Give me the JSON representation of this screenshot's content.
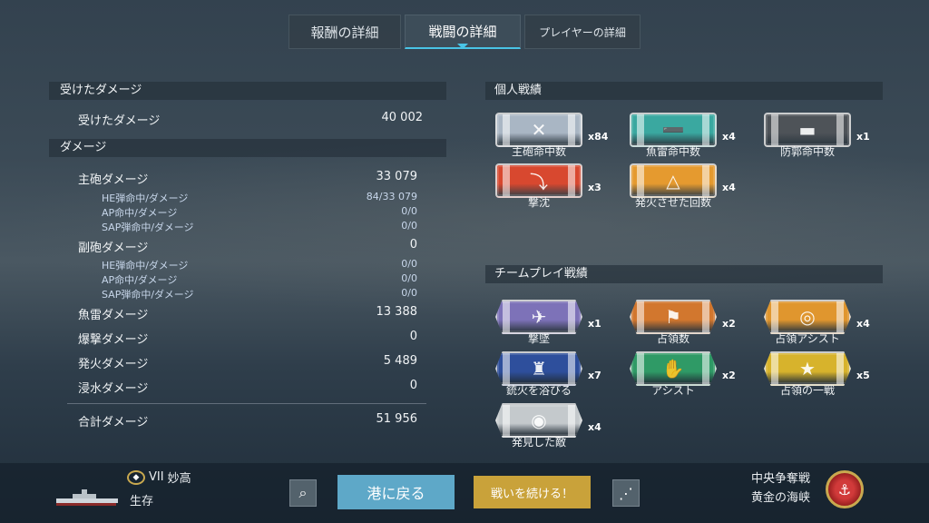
{
  "tabs": [
    "報酬の詳細",
    "戦闘の詳細",
    "プレイヤーの詳細"
  ],
  "left": {
    "received_header": "受けたダメージ",
    "received_label": "受けたダメージ",
    "received_value": "40 002",
    "damage_header": "ダメージ",
    "main_label": "主砲ダメージ",
    "main_value": "33 079",
    "main_he_label": "HE弾命中/ダメージ",
    "main_he_value": "84/33 079",
    "main_ap_label": "AP命中/ダメージ",
    "main_ap_value": "0/0",
    "main_sap_label": "SAP弾命中/ダメージ",
    "main_sap_value": "0/0",
    "sec_label": "副砲ダメージ",
    "sec_value": "0",
    "sec_he_label": "HE弾命中/ダメージ",
    "sec_he_value": "0/0",
    "sec_ap_label": "AP命中/ダメージ",
    "sec_ap_value": "0/0",
    "sec_sap_label": "SAP弾命中/ダメージ",
    "sec_sap_value": "0/0",
    "torp_label": "魚雷ダメージ",
    "torp_value": "13 388",
    "bomb_label": "爆撃ダメージ",
    "bomb_value": "0",
    "fire_label": "発火ダメージ",
    "fire_value": "5 489",
    "flood_label": "浸水ダメージ",
    "flood_value": "0",
    "total_label": "合計ダメージ",
    "total_value": "51 956"
  },
  "personal": {
    "header": "個人戦績",
    "medals": [
      {
        "label": "主砲命中数",
        "count": "x84",
        "color": "#a9b6c4",
        "glyph": "✕"
      },
      {
        "label": "魚雷命中数",
        "count": "x4",
        "color": "#3aa8a0",
        "glyph": "➖"
      },
      {
        "label": "防郭命中数",
        "count": "x1",
        "color": "#4e5358",
        "glyph": "▬"
      },
      {
        "label": "撃沈",
        "count": "x3",
        "color": "#d8482f",
        "glyph": "⤵"
      },
      {
        "label": "発火させた回数",
        "count": "x4",
        "color": "#e59a2f",
        "glyph": "△"
      }
    ]
  },
  "team": {
    "header": "チームプレイ戦績",
    "medals": [
      {
        "label": "撃墜",
        "count": "x1",
        "color": "#7d72b8",
        "glyph": "✈"
      },
      {
        "label": "占領数",
        "count": "x2",
        "color": "#d2772e",
        "glyph": "⚑"
      },
      {
        "label": "占領アシスト",
        "count": "x4",
        "color": "#e0962e",
        "glyph": "◎"
      },
      {
        "label": "銃火を浴びる",
        "count": "x7",
        "color": "#2e4f9c",
        "glyph": "♜"
      },
      {
        "label": "アシスト",
        "count": "x2",
        "color": "#2f9a66",
        "glyph": "✋"
      },
      {
        "label": "占領の一戦",
        "count": "x5",
        "color": "#d7b32c",
        "glyph": "★"
      },
      {
        "label": "発見した敵",
        "count": "x4",
        "color": "#c4c9cc",
        "glyph": "◉"
      }
    ]
  },
  "bottom": {
    "tier": "VII",
    "ship_name": "妙高",
    "status": "生存",
    "port_label": "港に戻る",
    "continue_label": "戦いを続ける！",
    "mode_line1": "中央争奪戦",
    "mode_line2": "黄金の海峡"
  }
}
